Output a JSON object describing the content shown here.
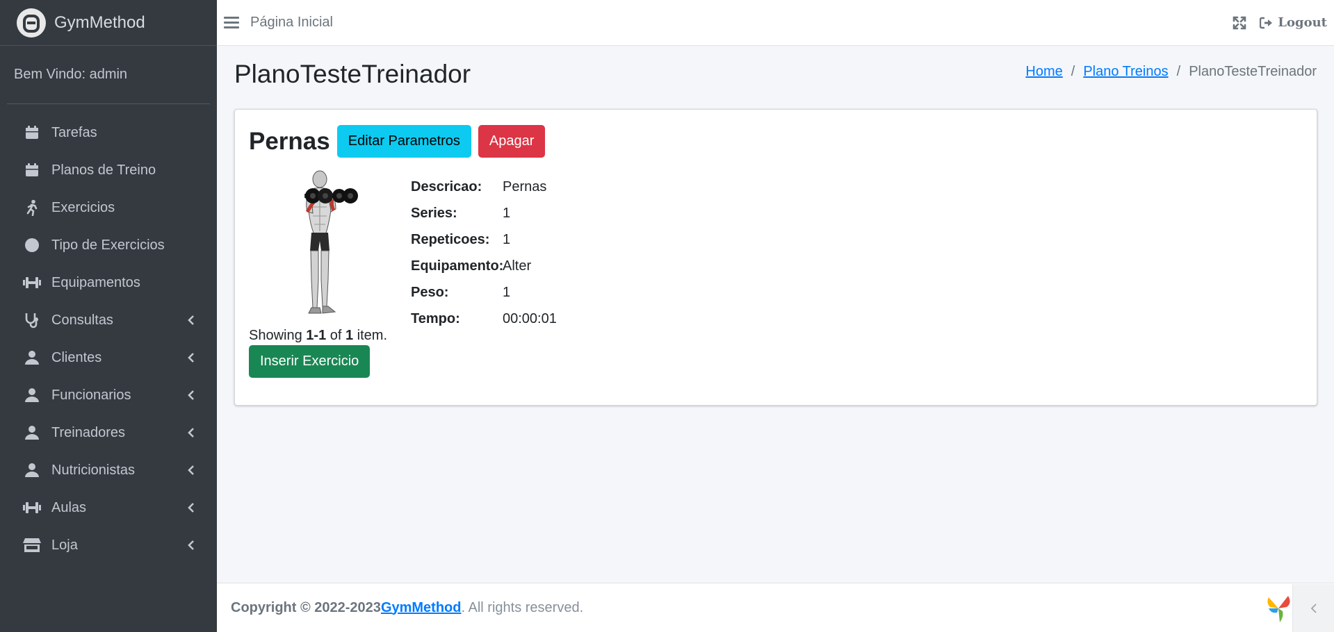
{
  "brand": {
    "name": "GymMethod"
  },
  "user": {
    "welcome": "Bem Vindo: admin"
  },
  "sidebar": {
    "items": [
      {
        "label": "Tarefas",
        "icon": "calendar-icon",
        "expandable": false
      },
      {
        "label": "Planos de Treino",
        "icon": "calendar-icon",
        "expandable": false
      },
      {
        "label": "Exercicios",
        "icon": "running-icon",
        "expandable": false
      },
      {
        "label": "Tipo de Exercicios",
        "icon": "circle-icon",
        "expandable": false
      },
      {
        "label": "Equipamentos",
        "icon": "dumbbell-icon",
        "expandable": false
      },
      {
        "label": "Consultas",
        "icon": "stethoscope-icon",
        "expandable": true
      },
      {
        "label": "Clientes",
        "icon": "user-icon",
        "expandable": true
      },
      {
        "label": "Funcionarios",
        "icon": "user-icon",
        "expandable": true
      },
      {
        "label": "Treinadores",
        "icon": "user-icon",
        "expandable": true
      },
      {
        "label": "Nutricionistas",
        "icon": "user-icon",
        "expandable": true
      },
      {
        "label": "Aulas",
        "icon": "dumbbell-icon",
        "expandable": true
      },
      {
        "label": "Loja",
        "icon": "store-icon",
        "expandable": true
      }
    ]
  },
  "header": {
    "home_link": "Página Inicial",
    "logout": "Logout"
  },
  "page": {
    "title": "PlanoTesteTreinador",
    "breadcrumb": {
      "home": "Home",
      "plans": "Plano Treinos",
      "current": "PlanoTesteTreinador"
    }
  },
  "card": {
    "title": "Pernas",
    "edit_button": "Editar Parametros",
    "delete_button": "Apagar",
    "details": [
      {
        "key": "Descricao:",
        "value": "Pernas"
      },
      {
        "key": "Series:",
        "value": "1"
      },
      {
        "key": "Repeticoes:",
        "value": "1"
      },
      {
        "key": "Equipamento:",
        "value": "Alter"
      },
      {
        "key": "Peso:",
        "value": "1"
      },
      {
        "key": "Tempo:",
        "value": "00:00:01"
      }
    ],
    "summary": {
      "prefix": "Showing ",
      "range": "1-1",
      "middle": " of ",
      "total": "1",
      "suffix": " item."
    },
    "insert_button": "Inserir Exercicio"
  },
  "footer": {
    "copyright": "Copyright © 2022-2023 ",
    "brand_link": "GymMethod",
    "tail": ". All rights reserved."
  },
  "colors": {
    "sidebar": "#343a40",
    "info": "#0dcaf0",
    "danger": "#dc3545",
    "success": "#198754",
    "link": "#007bff"
  }
}
